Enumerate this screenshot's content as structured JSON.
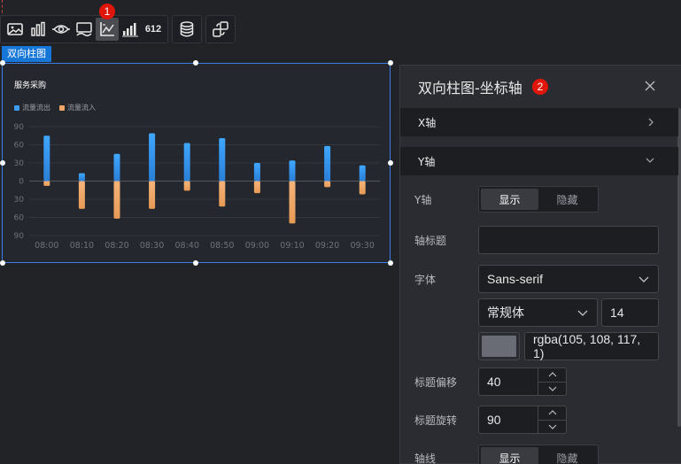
{
  "badges": {
    "toolbar": "1",
    "panel": "2"
  },
  "toolbar": {
    "icons": [
      "image-icon",
      "bar-chart-icon",
      "eye-target-icon",
      "monitor-icon",
      "axis-icon",
      "bar-level-icon",
      "number-612-icon",
      "database-icon",
      "transform-icon"
    ],
    "number_label": "612",
    "active": "axis-icon"
  },
  "component_label": "双向柱图",
  "chart_data": {
    "type": "bar",
    "title": "服务采购",
    "legend_position": "top-left",
    "grid": true,
    "categories": [
      "08:00",
      "08:10",
      "08:20",
      "08:30",
      "08:40",
      "08:50",
      "09:00",
      "09:10",
      "09:20",
      "09:30"
    ],
    "series": [
      {
        "name": "流量流出",
        "values": [
          75,
          13,
          45,
          79,
          63,
          71,
          30,
          34,
          58,
          26
        ],
        "color": "#3d9cf0"
      },
      {
        "name": "流量流入",
        "values": [
          -8,
          -46,
          -62,
          -46,
          -16,
          -42,
          -20,
          -70,
          -10,
          -22
        ],
        "color": "#f2a666"
      }
    ],
    "y_ticks": [
      "90",
      "60",
      "30",
      "0",
      "30",
      "60",
      "90"
    ],
    "ylim": [
      -90,
      90
    ]
  },
  "panel": {
    "title": "双向柱图-坐标轴",
    "sections": [
      {
        "label": "X轴",
        "expanded": false
      },
      {
        "label": "Y轴",
        "expanded": true
      }
    ],
    "fields": {
      "y_axis": {
        "label": "Y轴",
        "options": [
          "显示",
          "隐藏"
        ],
        "selected": "显示"
      },
      "axis_title": {
        "label": "轴标题",
        "value": "",
        "placeholder": ""
      },
      "font": {
        "label": "字体",
        "family": "Sans-serif",
        "weight": "常规体",
        "size": "14",
        "color_value": "rgba(105, 108, 117, 1)",
        "color": "#696c75"
      },
      "title_offset": {
        "label": "标题偏移",
        "value": "40"
      },
      "title_rotate": {
        "label": "标题旋转",
        "value": "90"
      },
      "axis_line": {
        "label": "轴线",
        "options": [
          "显示",
          "隐藏"
        ],
        "selected": "显示"
      }
    }
  }
}
